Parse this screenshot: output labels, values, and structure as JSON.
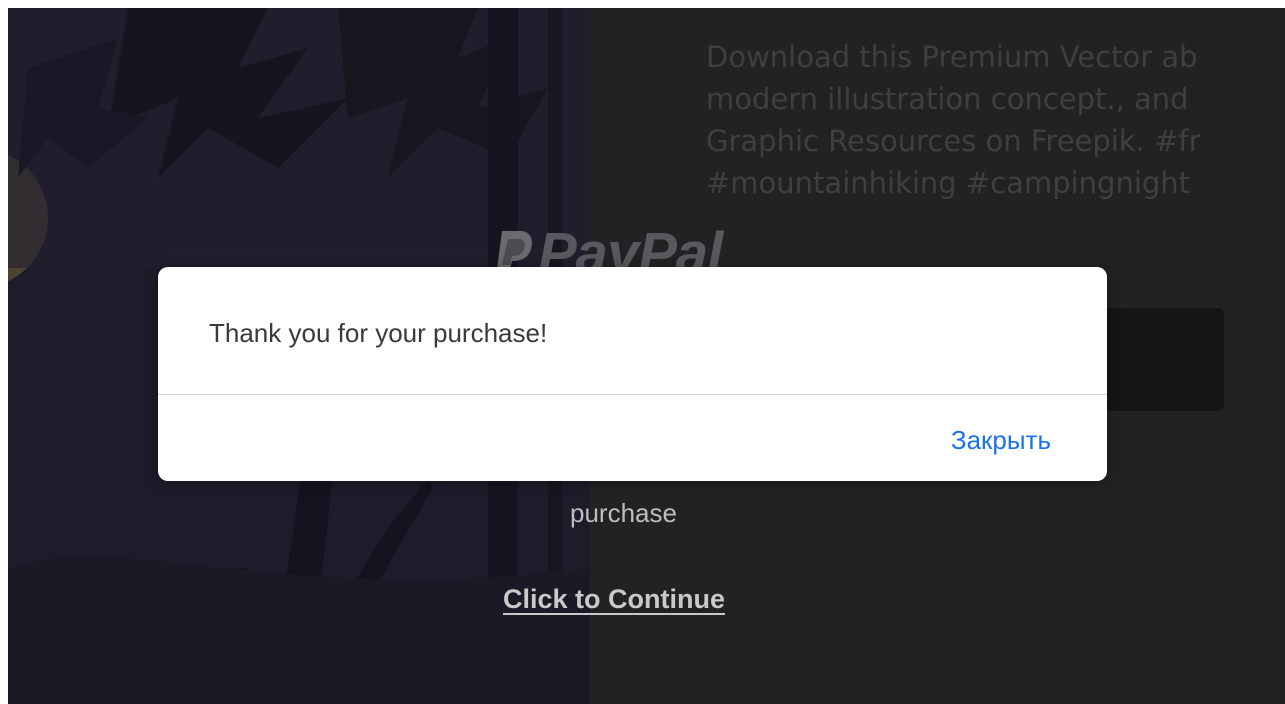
{
  "background": {
    "description_lines": [
      "Download this Premium Vector ab",
      "modern illustration concept., and",
      "Graphic Resources on Freepik. #fr",
      "#mountainhiking #campingnight"
    ],
    "paypal_logo_text": "PayPal",
    "purchase_text": "purchase",
    "continue_link": "Click to Continue"
  },
  "dialog": {
    "message": "Thank you for your purchase!",
    "close_label": "Закрыть"
  },
  "colors": {
    "page_bg": "#1f1f20",
    "dialog_bg": "#ffffff",
    "link_blue": "#1a73e8"
  },
  "icons": {
    "paypal_mark": "paypal-logo-icon"
  }
}
